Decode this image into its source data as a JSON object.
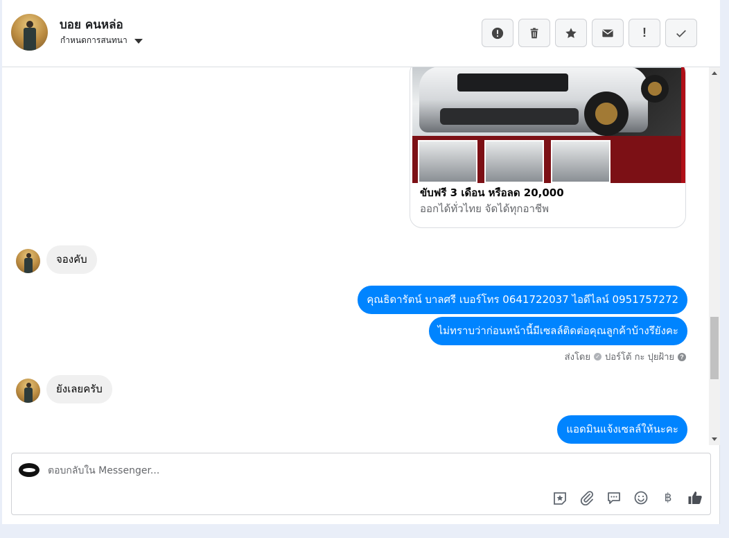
{
  "header": {
    "contact_name": "บอย คนหล่อ",
    "assign_label": "กำหนดการสนทนา"
  },
  "conversation": {
    "product_card": {
      "title": "ขับฟรี 3 เดือน หรือลด 20,000",
      "subtitle": "ออกได้ทั่วไทย จัดได้ทุกอาชีพ"
    },
    "messages": [
      {
        "from": "customer",
        "text": "จองคับ"
      },
      {
        "from": "page",
        "text": "คุณธิดารัตน์ บาลศรี เบอร์โทร 0641722037  ไอดีไลน์ 0951757272"
      },
      {
        "from": "page",
        "text": "ไม่ทราบว่าก่อนหน้านี้มีเซลล์ติดต่อคุณลูกค้าบ้างรึยังคะ"
      },
      {
        "from": "customer",
        "text": "ยังเลยครับ"
      },
      {
        "from": "page",
        "text": "แอดมินแจ้งเซลล์ให้นะคะ"
      }
    ],
    "sent_by": {
      "prefix": "ส่งโดย",
      "name": "ปอร์โต้ กะ ปุยฝ้าย"
    }
  },
  "composer": {
    "placeholder": "ตอบกลับใน Messenger...",
    "baht_symbol": "฿"
  },
  "icons": {
    "toolbar": [
      "alert-circle-icon",
      "trash-icon",
      "star-icon",
      "envelope-icon",
      "exclamation-icon",
      "checkmark-icon"
    ],
    "composer": [
      "sticker-icon",
      "paperclip-icon",
      "chat-bubble-icon",
      "smiley-icon",
      "baht-icon",
      "thumbs-up-icon"
    ]
  },
  "colors": {
    "outgoing_bubble": "#0084ff",
    "incoming_bubble": "#f0f0f0"
  }
}
